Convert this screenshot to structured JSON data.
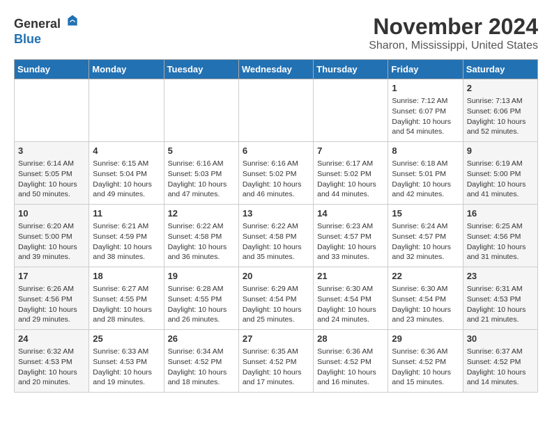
{
  "logo": {
    "general": "General",
    "blue": "Blue"
  },
  "header": {
    "month_year": "November 2024",
    "location": "Sharon, Mississippi, United States"
  },
  "days_of_week": [
    "Sunday",
    "Monday",
    "Tuesday",
    "Wednesday",
    "Thursday",
    "Friday",
    "Saturday"
  ],
  "weeks": [
    [
      {
        "day": "",
        "sunrise": "",
        "sunset": "",
        "daylight": ""
      },
      {
        "day": "",
        "sunrise": "",
        "sunset": "",
        "daylight": ""
      },
      {
        "day": "",
        "sunrise": "",
        "sunset": "",
        "daylight": ""
      },
      {
        "day": "",
        "sunrise": "",
        "sunset": "",
        "daylight": ""
      },
      {
        "day": "",
        "sunrise": "",
        "sunset": "",
        "daylight": ""
      },
      {
        "day": "1",
        "sunrise": "Sunrise: 7:12 AM",
        "sunset": "Sunset: 6:07 PM",
        "daylight": "Daylight: 10 hours and 54 minutes."
      },
      {
        "day": "2",
        "sunrise": "Sunrise: 7:13 AM",
        "sunset": "Sunset: 6:06 PM",
        "daylight": "Daylight: 10 hours and 52 minutes."
      }
    ],
    [
      {
        "day": "3",
        "sunrise": "Sunrise: 6:14 AM",
        "sunset": "Sunset: 5:05 PM",
        "daylight": "Daylight: 10 hours and 50 minutes."
      },
      {
        "day": "4",
        "sunrise": "Sunrise: 6:15 AM",
        "sunset": "Sunset: 5:04 PM",
        "daylight": "Daylight: 10 hours and 49 minutes."
      },
      {
        "day": "5",
        "sunrise": "Sunrise: 6:16 AM",
        "sunset": "Sunset: 5:03 PM",
        "daylight": "Daylight: 10 hours and 47 minutes."
      },
      {
        "day": "6",
        "sunrise": "Sunrise: 6:16 AM",
        "sunset": "Sunset: 5:02 PM",
        "daylight": "Daylight: 10 hours and 46 minutes."
      },
      {
        "day": "7",
        "sunrise": "Sunrise: 6:17 AM",
        "sunset": "Sunset: 5:02 PM",
        "daylight": "Daylight: 10 hours and 44 minutes."
      },
      {
        "day": "8",
        "sunrise": "Sunrise: 6:18 AM",
        "sunset": "Sunset: 5:01 PM",
        "daylight": "Daylight: 10 hours and 42 minutes."
      },
      {
        "day": "9",
        "sunrise": "Sunrise: 6:19 AM",
        "sunset": "Sunset: 5:00 PM",
        "daylight": "Daylight: 10 hours and 41 minutes."
      }
    ],
    [
      {
        "day": "10",
        "sunrise": "Sunrise: 6:20 AM",
        "sunset": "Sunset: 5:00 PM",
        "daylight": "Daylight: 10 hours and 39 minutes."
      },
      {
        "day": "11",
        "sunrise": "Sunrise: 6:21 AM",
        "sunset": "Sunset: 4:59 PM",
        "daylight": "Daylight: 10 hours and 38 minutes."
      },
      {
        "day": "12",
        "sunrise": "Sunrise: 6:22 AM",
        "sunset": "Sunset: 4:58 PM",
        "daylight": "Daylight: 10 hours and 36 minutes."
      },
      {
        "day": "13",
        "sunrise": "Sunrise: 6:22 AM",
        "sunset": "Sunset: 4:58 PM",
        "daylight": "Daylight: 10 hours and 35 minutes."
      },
      {
        "day": "14",
        "sunrise": "Sunrise: 6:23 AM",
        "sunset": "Sunset: 4:57 PM",
        "daylight": "Daylight: 10 hours and 33 minutes."
      },
      {
        "day": "15",
        "sunrise": "Sunrise: 6:24 AM",
        "sunset": "Sunset: 4:57 PM",
        "daylight": "Daylight: 10 hours and 32 minutes."
      },
      {
        "day": "16",
        "sunrise": "Sunrise: 6:25 AM",
        "sunset": "Sunset: 4:56 PM",
        "daylight": "Daylight: 10 hours and 31 minutes."
      }
    ],
    [
      {
        "day": "17",
        "sunrise": "Sunrise: 6:26 AM",
        "sunset": "Sunset: 4:56 PM",
        "daylight": "Daylight: 10 hours and 29 minutes."
      },
      {
        "day": "18",
        "sunrise": "Sunrise: 6:27 AM",
        "sunset": "Sunset: 4:55 PM",
        "daylight": "Daylight: 10 hours and 28 minutes."
      },
      {
        "day": "19",
        "sunrise": "Sunrise: 6:28 AM",
        "sunset": "Sunset: 4:55 PM",
        "daylight": "Daylight: 10 hours and 26 minutes."
      },
      {
        "day": "20",
        "sunrise": "Sunrise: 6:29 AM",
        "sunset": "Sunset: 4:54 PM",
        "daylight": "Daylight: 10 hours and 25 minutes."
      },
      {
        "day": "21",
        "sunrise": "Sunrise: 6:30 AM",
        "sunset": "Sunset: 4:54 PM",
        "daylight": "Daylight: 10 hours and 24 minutes."
      },
      {
        "day": "22",
        "sunrise": "Sunrise: 6:30 AM",
        "sunset": "Sunset: 4:54 PM",
        "daylight": "Daylight: 10 hours and 23 minutes."
      },
      {
        "day": "23",
        "sunrise": "Sunrise: 6:31 AM",
        "sunset": "Sunset: 4:53 PM",
        "daylight": "Daylight: 10 hours and 21 minutes."
      }
    ],
    [
      {
        "day": "24",
        "sunrise": "Sunrise: 6:32 AM",
        "sunset": "Sunset: 4:53 PM",
        "daylight": "Daylight: 10 hours and 20 minutes."
      },
      {
        "day": "25",
        "sunrise": "Sunrise: 6:33 AM",
        "sunset": "Sunset: 4:53 PM",
        "daylight": "Daylight: 10 hours and 19 minutes."
      },
      {
        "day": "26",
        "sunrise": "Sunrise: 6:34 AM",
        "sunset": "Sunset: 4:52 PM",
        "daylight": "Daylight: 10 hours and 18 minutes."
      },
      {
        "day": "27",
        "sunrise": "Sunrise: 6:35 AM",
        "sunset": "Sunset: 4:52 PM",
        "daylight": "Daylight: 10 hours and 17 minutes."
      },
      {
        "day": "28",
        "sunrise": "Sunrise: 6:36 AM",
        "sunset": "Sunset: 4:52 PM",
        "daylight": "Daylight: 10 hours and 16 minutes."
      },
      {
        "day": "29",
        "sunrise": "Sunrise: 6:36 AM",
        "sunset": "Sunset: 4:52 PM",
        "daylight": "Daylight: 10 hours and 15 minutes."
      },
      {
        "day": "30",
        "sunrise": "Sunrise: 6:37 AM",
        "sunset": "Sunset: 4:52 PM",
        "daylight": "Daylight: 10 hours and 14 minutes."
      }
    ]
  ]
}
